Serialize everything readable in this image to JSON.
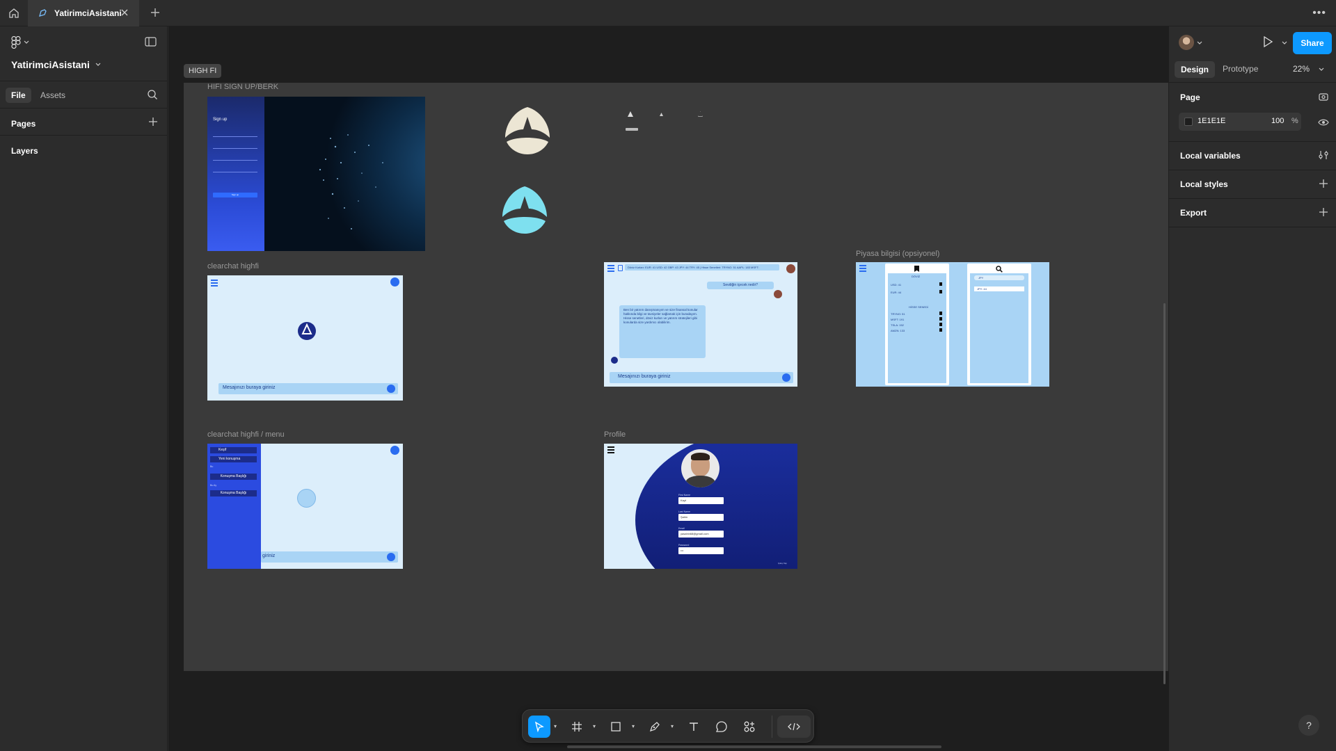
{
  "tab": {
    "title": "YatirimciAsistani"
  },
  "left_panel": {
    "file_name": "YatirimciAsistani",
    "tabs": [
      "File",
      "Assets"
    ],
    "pages_label": "Pages",
    "layers_label": "Layers"
  },
  "canvas": {
    "section_label": "HIGH FI",
    "frames": [
      {
        "label": "HIFI SIGN UP/BERK"
      },
      {
        "label": "clearchat highfi"
      },
      {
        "label": "Piyasa bilgisi (opsiyonel)"
      },
      {
        "label": "clearchat highfi / menu"
      },
      {
        "label": "Profile"
      }
    ],
    "signup": {
      "title": "Sign up",
      "button": "Sign up"
    },
    "clearchat": {
      "input_placeholder": "Mesajınızı buraya giriniz"
    },
    "chat": {
      "ticker": "Döviz Kurları: EUR: 41 USD: 42 GBP: 43 JPY: 44 TRY: 45 | Hisse Senetleri: TRYNO: 51 AAPL: 183 MSFT:",
      "user_message": "Sevdiğin içecek nedir?",
      "bot_message": "Ben bir yatırım danışmanıyım ve size finansal konular hakkında bilgi ve tavsiyeler sağlamak için buradayım. Hisse senetleri, döviz kurları ve yatırım stratejileri gibi konularda size yardımcı olabilirim.",
      "input_placeholder": "Mesajınızı buraya giriniz"
    },
    "market": {
      "doviz_title": "DÖVİZ",
      "doviz_rows": [
        "USD: 41",
        "EUR: 44"
      ],
      "hisse_title": "HİSSE SENEDİ",
      "hisse_rows": [
        "TRYNO: 51",
        "MSFT: 191",
        "TSLA: 152",
        "AMZN: 133"
      ],
      "search_row": "JPY: 44",
      "search_header": "JPY"
    },
    "menu": {
      "items": [
        "Keşif",
        "Yeni konuşma"
      ],
      "group1": "Bu",
      "conv1": "Konuşma Başlığı",
      "group2": "Bu Ay",
      "conv2": "Konuşma Başlığı",
      "input_placeholder": "giriniz"
    },
    "profile": {
      "fields": [
        {
          "label": "First Name",
          "value": "Kayt"
        },
        {
          "label": "Last Name",
          "value": "Şahin"
        },
        {
          "label": "Email",
          "value": "yasahin68@gmail.com"
        },
        {
          "label": "Password",
          "value": "•••"
        }
      ],
      "logout": "Çıkış Yap"
    }
  },
  "right_panel": {
    "share_label": "Share",
    "tabs": [
      "Design",
      "Prototype"
    ],
    "zoom": "22%",
    "page_label": "Page",
    "bg_hex": "1E1E1E",
    "bg_opacity": "100",
    "bg_opacity_unit": "%",
    "local_variables": "Local variables",
    "local_styles": "Local styles",
    "export": "Export",
    "help": "?"
  },
  "colors": {
    "accent": "#0d99ff",
    "canvas_bg": "#1E1E1E",
    "mock_light_blue": "#dceefb",
    "mock_blue": "#1e5eff",
    "mock_navy": "#12227a",
    "logo_cream": "#ece6d4",
    "logo_cyan": "#7ee0ef"
  }
}
